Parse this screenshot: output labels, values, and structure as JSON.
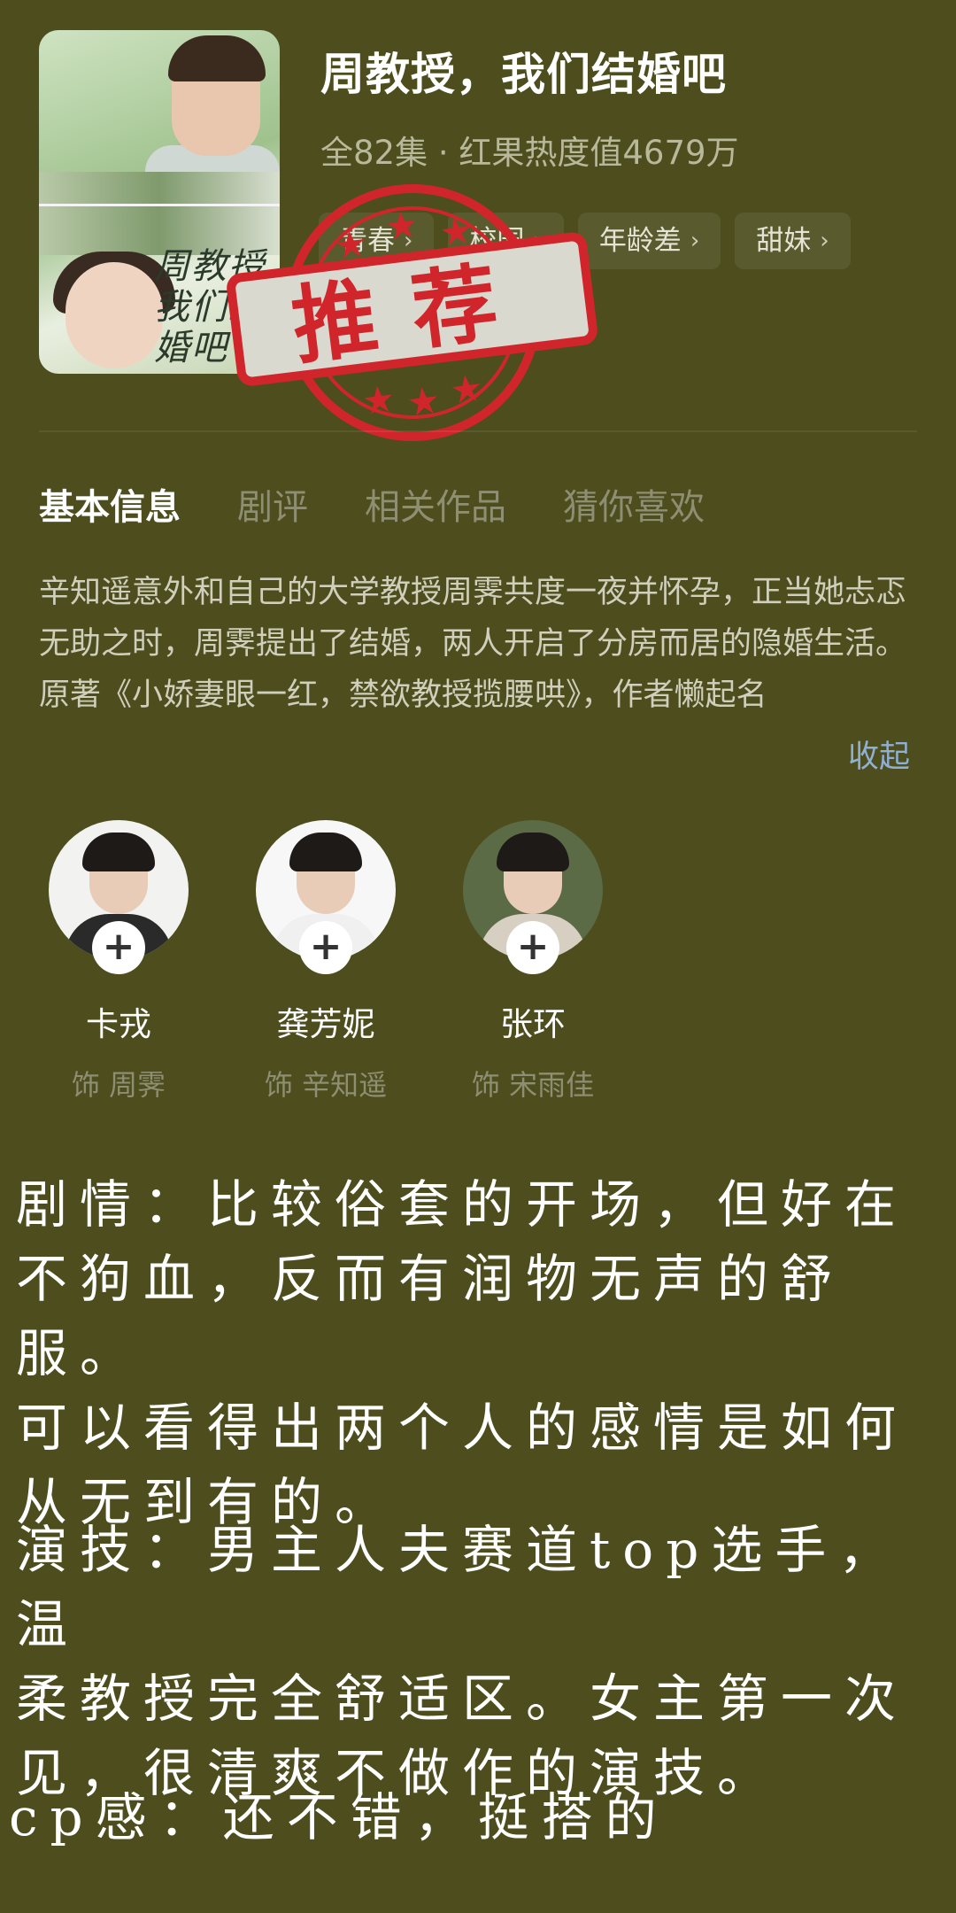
{
  "drama": {
    "title": "周教授，我们结婚吧",
    "meta": "全82集 · 红果热度值4679万",
    "tags": [
      "青春",
      "校园",
      "年龄差",
      "甜妹"
    ],
    "poster_title": "周教授我们结婚吧"
  },
  "stamp": {
    "text": "推荐",
    "color": "#d0262b"
  },
  "tabs": [
    "基本信息",
    "剧评",
    "相关作品",
    "猜你喜欢"
  ],
  "active_tab": "基本信息",
  "description": "辛知遥意外和自己的大学教授周霁共度一夜并怀孕，正当她忐忑无助之时，周霁提出了结婚，两人开启了分房而居的隐婚生活。原著《小娇妻眼一红，禁欲教授揽腰哄》，作者懒起名",
  "collapse_label": "收起",
  "cast": [
    {
      "name": "卡戎",
      "role": "饰 周霁"
    },
    {
      "name": "龚芳妮",
      "role": "饰 辛知遥"
    },
    {
      "name": "张环",
      "role": "饰 宋雨佳"
    }
  ],
  "review": {
    "plot": "剧情：比较俗套的开场，但好在\n不狗血，反而有润物无声的舒服。\n可以看得出两个人的感情是如何\n从无到有的。",
    "acting": "演技：男主人夫赛道top选手，温\n柔教授完全舒适区。女主第一次\n见，很清爽不做作的演技。",
    "cp": "cp感：还不错，挺搭的"
  },
  "colors": {
    "background": "#4d4d1e",
    "link": "#8fb0d4"
  }
}
